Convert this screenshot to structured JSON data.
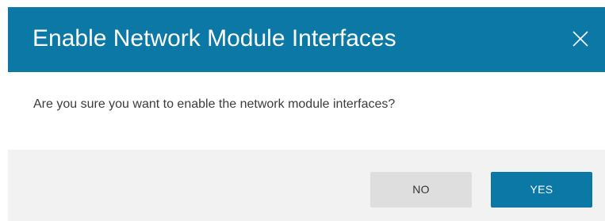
{
  "dialog": {
    "title": "Enable Network Module Interfaces",
    "close_icon": "close-icon",
    "message": "Are you sure you want to enable the network module interfaces?",
    "buttons": {
      "no_label": "NO",
      "yes_label": "YES"
    }
  },
  "colors": {
    "header_background": "#0b78a6",
    "primary_button": "#0b78a6",
    "secondary_button": "#dedede",
    "footer_background": "#f2f2f2",
    "message_text": "#3c3c3c"
  }
}
